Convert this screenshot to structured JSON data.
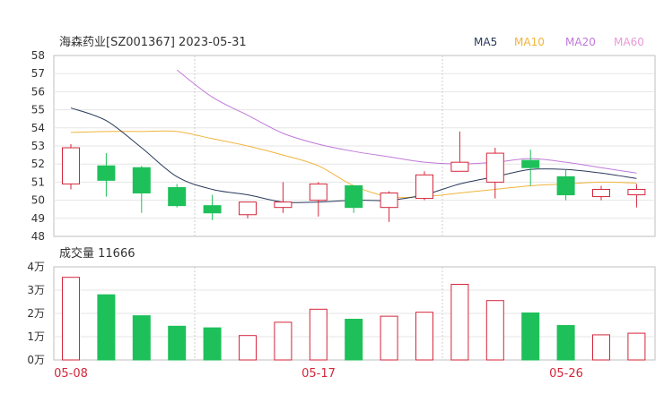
{
  "chart_data": {
    "type": "candlestick",
    "title": "海森药业[SZ001367] 2023-05-31",
    "legend": [
      {
        "name": "MA5",
        "color": "#2a3a5a"
      },
      {
        "name": "MA10",
        "color": "#f0b43c"
      },
      {
        "name": "MA20",
        "color": "#c07ad8"
      },
      {
        "name": "MA60",
        "color": "#e89ad8"
      }
    ],
    "price_axis": {
      "ylim": [
        48,
        58
      ],
      "ticks": [
        "58",
        "57",
        "56",
        "55",
        "54",
        "53",
        "52",
        "51",
        "50",
        "49",
        "48"
      ]
    },
    "candles": [
      {
        "open": 50.9,
        "close": 52.9,
        "high": 53.1,
        "low": 50.6
      },
      {
        "open": 51.9,
        "close": 51.1,
        "high": 52.6,
        "low": 50.2
      },
      {
        "open": 51.8,
        "close": 50.4,
        "high": 51.9,
        "low": 49.3
      },
      {
        "open": 50.7,
        "close": 49.7,
        "high": 50.9,
        "low": 49.6
      },
      {
        "open": 49.7,
        "close": 49.3,
        "high": 50.3,
        "low": 48.9
      },
      {
        "open": 49.2,
        "close": 49.9,
        "high": 49.9,
        "low": 49.0
      },
      {
        "open": 49.6,
        "close": 49.9,
        "high": 51.0,
        "low": 49.3
      },
      {
        "open": 50.0,
        "close": 50.9,
        "high": 51.0,
        "low": 49.1
      },
      {
        "open": 50.8,
        "close": 49.6,
        "high": 50.8,
        "low": 49.3
      },
      {
        "open": 49.6,
        "close": 50.4,
        "high": 50.5,
        "low": 48.8
      },
      {
        "open": 50.1,
        "close": 51.4,
        "high": 51.6,
        "low": 50.0
      },
      {
        "open": 51.6,
        "close": 52.1,
        "high": 53.8,
        "low": 51.6
      },
      {
        "open": 51.0,
        "close": 52.6,
        "high": 52.9,
        "low": 50.1
      },
      {
        "open": 52.2,
        "close": 51.8,
        "high": 52.8,
        "low": 50.8
      },
      {
        "open": 51.3,
        "close": 50.3,
        "high": 51.7,
        "low": 50.0
      },
      {
        "open": 50.2,
        "close": 50.6,
        "high": 50.8,
        "low": 50.0
      },
      {
        "open": 50.3,
        "close": 50.6,
        "high": 50.9,
        "low": 49.6
      }
    ],
    "ma5": [
      55.1,
      54.4,
      52.9,
      51.3,
      50.6,
      50.3,
      49.9,
      49.9,
      50.0,
      50.0,
      50.3,
      50.9,
      51.3,
      51.7,
      51.7,
      51.5,
      51.2
    ],
    "ma10": [
      53.75,
      53.8,
      53.8,
      53.8,
      53.4,
      53.0,
      52.5,
      51.9,
      50.8,
      50.2,
      50.2,
      50.4,
      50.6,
      50.8,
      50.9,
      51.0,
      50.95
    ],
    "ma20": [
      null,
      null,
      null,
      57.2,
      55.7,
      54.7,
      53.7,
      53.1,
      52.7,
      52.4,
      52.1,
      52.0,
      52.1,
      52.3,
      52.1,
      51.8,
      51.5
    ],
    "volume_title": "成交量 11666",
    "volume_axis": {
      "ylim": [
        0,
        4
      ],
      "ticks": [
        "4万",
        "3万",
        "2万",
        "1万",
        "0万"
      ]
    },
    "volumes": [
      3.55,
      2.8,
      1.9,
      1.45,
      1.38,
      1.05,
      1.62,
      2.18,
      1.75,
      1.88,
      2.05,
      3.25,
      2.55,
      2.02,
      1.48,
      1.08,
      1.15
    ],
    "x_labels": [
      "05-08",
      "05-17",
      "05-26"
    ]
  }
}
